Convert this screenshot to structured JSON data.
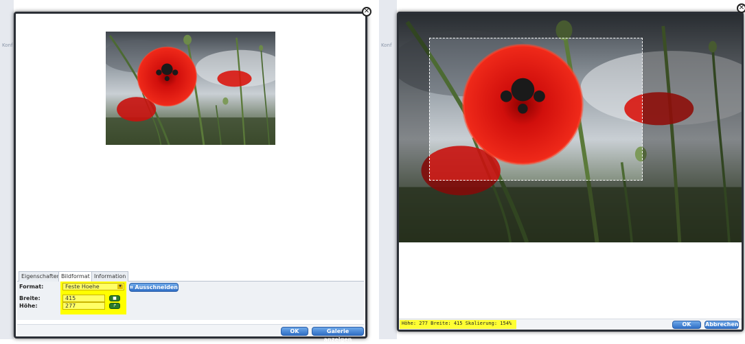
{
  "left": {
    "tabs": [
      "Eigenschaften",
      "Bildformat",
      "Information"
    ],
    "active_tab": "Bildformat",
    "format_label": "Format:",
    "format_value": "Feste Hoehe",
    "crop_button": "Ausschneiden",
    "width_label": "Breite:",
    "width_value": "415",
    "height_label": "Höhe:",
    "height_value": "277",
    "ok_button": "OK",
    "gallery_button": "Galerie anzeigen",
    "bg_text": "Konf"
  },
  "right": {
    "status": "Höhe:  277  Breite:  415  Skalierung:  154%",
    "ok_button": "OK",
    "cancel_button": "Abbrechen",
    "bg_text": "Konf"
  },
  "colors": {
    "highlight": "#ffff00",
    "button_blue": "#2f6fc6",
    "poppy_red": "#d9120f"
  },
  "icons": {
    "close": "close-x-icon",
    "crop": "crop-icon",
    "lock": "lock-icon",
    "reset": "reset-icon",
    "dropdown": "chevron-down-icon"
  }
}
